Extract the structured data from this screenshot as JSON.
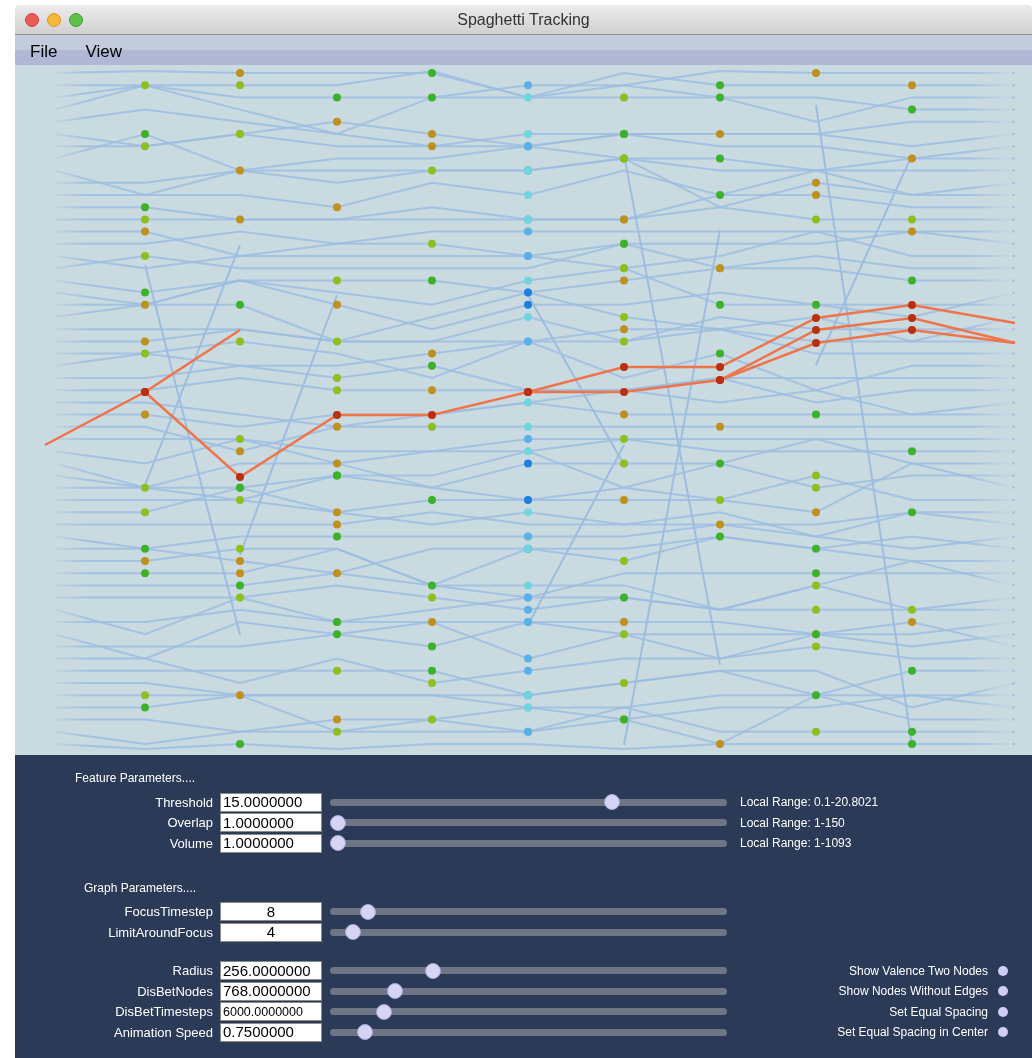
{
  "window": {
    "title": "Spaghetti Tracking"
  },
  "menu": [
    "File",
    "View"
  ],
  "feature_parameters": {
    "title": "Feature Parameters....",
    "rows": [
      {
        "label": "Threshold",
        "value": "15.0000000",
        "level": 0.72,
        "range": "Local Range: 0.1-20.8021"
      },
      {
        "label": "Overlap",
        "value": "1.0000000",
        "level": 0,
        "range": "Local Range: 1-150"
      },
      {
        "label": "Volume",
        "value": "1.0000000",
        "level": 0,
        "range": "Local Range: 1-1093"
      }
    ]
  },
  "graph_parameters": {
    "title": "Graph Parameters....",
    "rows": [
      {
        "label": "FocusTimestep",
        "value": "8",
        "level": 0.08
      },
      {
        "label": "LimitAroundFocus",
        "value": "4",
        "level": 0.04
      }
    ]
  },
  "layout_parameters": {
    "rows": [
      {
        "label": "Radius",
        "value": "256.0000000",
        "level": 0.25,
        "option": "Show Valence Two Nodes"
      },
      {
        "label": "DisBetNodes",
        "value": "768.0000000",
        "level": 0.15,
        "option": "Show Nodes Without Edges"
      },
      {
        "label": "DisBetTimesteps",
        "value": "6000.0000000",
        "level": 0.12,
        "option": "Set Equal Spacing"
      },
      {
        "label": "Animation Speed",
        "value": "0.7500000",
        "level": 0.07,
        "option": "Set Equal Spacing in Center"
      }
    ]
  }
}
